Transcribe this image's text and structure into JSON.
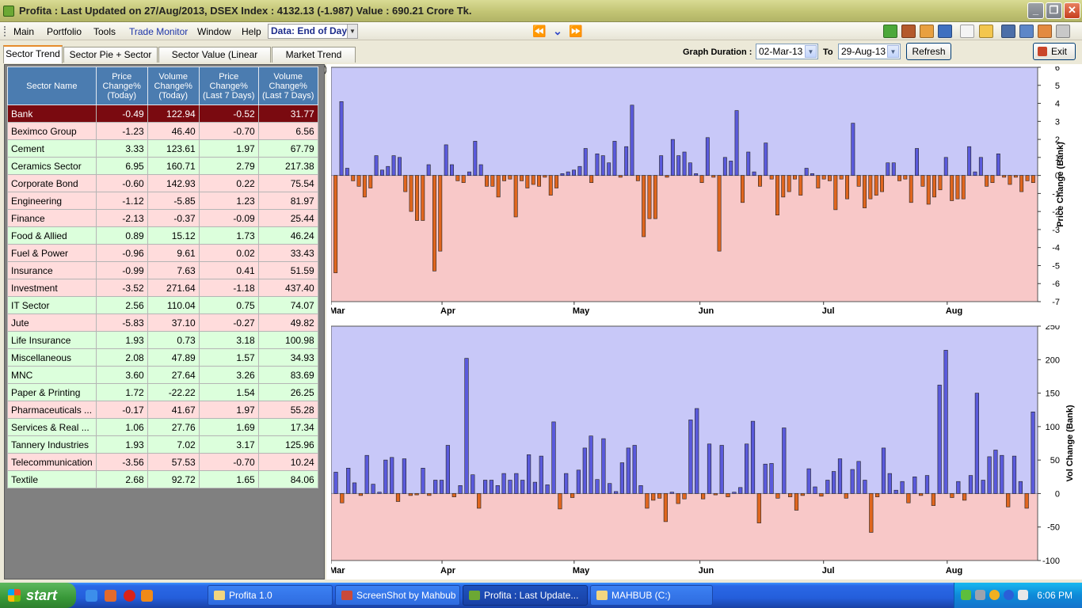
{
  "window": {
    "title": "Profita : Last Updated on 27/Aug/2013,  DSEX Index : 4132.13 (-1.987)  Value : 690.21 Crore Tk.",
    "app_icon": "profita-logo-icon",
    "controls": {
      "minimize": "_",
      "maximize": "❐",
      "close": "✕"
    }
  },
  "menubar": {
    "items": [
      "Main",
      "Portfolio",
      "Tools",
      "Trade Monitor",
      "Window",
      "Help"
    ],
    "data_select": "Data: End of Day",
    "nav": {
      "first": "⏪",
      "down": "⌄",
      "last": "⏩"
    },
    "toolbar_icons": [
      "download-icon",
      "chart-bar-icon",
      "candlestick-icon",
      "refresh-swap-icon",
      "edit-icon",
      "folder-icon",
      "portfolio-icon",
      "calculator-icon",
      "list-icon",
      "printer-icon"
    ]
  },
  "tabs": [
    "Sector Trend",
    "Sector Pie + Sector PE",
    "Sector Value (Linear Graph)",
    "Market Trend (EOD)"
  ],
  "active_tab": "Sector Trend",
  "duration": {
    "label": "Graph Duration :",
    "from": "02-Mar-13",
    "to_label": "To",
    "to": "29-Aug-13",
    "refresh": "Refresh",
    "exit": "Exit"
  },
  "table": {
    "headers": [
      "Sector Name",
      "Price Change% (Today)",
      "Volume Change% (Today)",
      "Price Change% (Last 7 Days)",
      "Volume Change% (Last 7 Days)"
    ],
    "selected_row": "Bank",
    "rows": [
      [
        "Bank",
        "-0.49",
        "122.94",
        "-0.52",
        "31.77"
      ],
      [
        "Beximco Group",
        "-1.23",
        "46.40",
        "-0.70",
        "6.56"
      ],
      [
        "Cement",
        "3.33",
        "123.61",
        "1.97",
        "67.79"
      ],
      [
        "Ceramics Sector",
        "6.95",
        "160.71",
        "2.79",
        "217.38"
      ],
      [
        "Corporate Bond",
        "-0.60",
        "142.93",
        "0.22",
        "75.54"
      ],
      [
        "Engineering",
        "-1.12",
        "-5.85",
        "1.23",
        "81.97"
      ],
      [
        "Finance",
        "-2.13",
        "-0.37",
        "-0.09",
        "25.44"
      ],
      [
        "Food & Allied",
        "0.89",
        "15.12",
        "1.73",
        "46.24"
      ],
      [
        "Fuel & Power",
        "-0.96",
        "9.61",
        "0.02",
        "33.43"
      ],
      [
        "Insurance",
        "-0.99",
        "7.63",
        "0.41",
        "51.59"
      ],
      [
        "Investment",
        "-3.52",
        "271.64",
        "-1.18",
        "437.40"
      ],
      [
        "IT Sector",
        "2.56",
        "110.04",
        "0.75",
        "74.07"
      ],
      [
        "Jute",
        "-5.83",
        "37.10",
        "-0.27",
        "49.82"
      ],
      [
        "Life Insurance",
        "1.93",
        "0.73",
        "3.18",
        "100.98"
      ],
      [
        "Miscellaneous",
        "2.08",
        "47.89",
        "1.57",
        "34.93"
      ],
      [
        "MNC",
        "3.60",
        "27.64",
        "3.26",
        "83.69"
      ],
      [
        "Paper & Printing",
        "1.72",
        "-22.22",
        "1.54",
        "26.25"
      ],
      [
        "Pharmaceuticals ...",
        "-0.17",
        "41.67",
        "1.97",
        "55.28"
      ],
      [
        "Services & Real ...",
        "1.06",
        "27.76",
        "1.69",
        "17.34"
      ],
      [
        "Tannery Industries",
        "1.93",
        "7.02",
        "3.17",
        "125.96"
      ],
      [
        "Telecommunication",
        "-3.56",
        "57.53",
        "-0.70",
        "10.24"
      ],
      [
        "Textile",
        "2.68",
        "92.72",
        "1.65",
        "84.06"
      ]
    ]
  },
  "chart_data": [
    {
      "type": "bar",
      "ylabel": "Price Change (Bank)",
      "ylim": [
        -7,
        6
      ],
      "yticks": [
        6,
        5,
        4,
        3,
        2,
        1,
        0,
        -1,
        -2,
        -3,
        -4,
        -5,
        -6,
        -7
      ],
      "xticks": [
        "Mar",
        "Apr",
        "May",
        "Jun",
        "Jul",
        "Aug"
      ],
      "colors": {
        "positive": "#5A5ADC",
        "negative": "#E0661E",
        "bg_positive": "#C8C8F8",
        "bg_negative": "#F8C8C8"
      },
      "values": [
        -5.4,
        4.1,
        0.4,
        -0.3,
        -0.6,
        -1.2,
        -0.7,
        1.1,
        0.3,
        0.5,
        1.1,
        1.0,
        -0.9,
        -2.0,
        -2.5,
        -2.5,
        0.6,
        -5.3,
        -4.2,
        1.7,
        0.6,
        -0.3,
        -0.4,
        0.2,
        1.9,
        0.6,
        -0.6,
        -0.6,
        -1.2,
        -0.3,
        -0.2,
        -2.3,
        -0.3,
        -0.7,
        -0.5,
        -0.6,
        -0.1,
        -1.1,
        -0.7,
        0.1,
        0.2,
        0.3,
        0.5,
        1.5,
        -0.4,
        1.2,
        1.1,
        0.7,
        1.9,
        -0.1,
        1.6,
        3.9,
        -0.3,
        -3.4,
        -2.4,
        -2.4,
        1.1,
        -0.1,
        2.0,
        1.1,
        1.3,
        0.7,
        0.1,
        -0.4,
        2.1,
        -0.1,
        -4.2,
        1.0,
        0.8,
        3.6,
        -1.5,
        1.3,
        0.2,
        -0.6,
        1.8,
        -0.2,
        -2.2,
        -1.2,
        -0.9,
        -0.2,
        -1.1,
        0.4,
        0.1,
        -0.7,
        -0.2,
        -0.3,
        -1.9,
        -0.2,
        -1.3,
        2.9,
        -0.6,
        -1.8,
        -1.3,
        -1.1,
        -0.9,
        0.7,
        0.7,
        -0.3,
        -0.2,
        -1.5,
        1.5,
        -0.6,
        -1.6,
        -1.2,
        -0.8,
        1.0,
        -1.4,
        -1.3,
        -1.3,
        1.6,
        0.2,
        1.0,
        -0.6,
        -0.4,
        1.2,
        -0.1,
        -0.5,
        -0.1,
        -0.9,
        -0.3,
        -0.4
      ]
    },
    {
      "type": "bar",
      "ylabel": "Vol Change (Bank)",
      "ylim": [
        -100,
        250
      ],
      "yticks": [
        250,
        200,
        150,
        100,
        50,
        0,
        -50,
        -100
      ],
      "xticks": [
        "Mar",
        "Apr",
        "May",
        "Jun",
        "Jul",
        "Aug"
      ],
      "colors": {
        "positive": "#5A5ADC",
        "negative": "#E0661E",
        "bg_positive": "#C8C8F8",
        "bg_negative": "#F8C8C8"
      },
      "values": [
        32,
        -14,
        38,
        16,
        -3,
        57,
        14,
        2,
        50,
        54,
        -12,
        52,
        -3,
        -2,
        38,
        -3,
        20,
        20,
        72,
        -5,
        12,
        202,
        28,
        -22,
        20,
        20,
        12,
        30,
        20,
        30,
        20,
        58,
        17,
        56,
        13,
        107,
        -23,
        30,
        -6,
        35,
        68,
        86,
        21,
        82,
        15,
        3,
        46,
        68,
        72,
        12,
        -22,
        -10,
        -7,
        -42,
        2,
        -15,
        -8,
        110,
        127,
        -8,
        74,
        -2,
        72,
        -5,
        2,
        9,
        74,
        108,
        -44,
        44,
        45,
        -7,
        98,
        -5,
        -25,
        -3,
        37,
        10,
        -4,
        20,
        33,
        52,
        -7,
        36,
        48,
        20,
        -58,
        -5,
        68,
        30,
        5,
        18,
        -14,
        25,
        -3,
        27,
        -18,
        162,
        214,
        -6,
        18,
        -10,
        27,
        150,
        20,
        55,
        65,
        57,
        -20,
        56,
        18,
        -22,
        122
      ]
    }
  ],
  "taskbar": {
    "start": "start",
    "quicklaunch": [
      "ie-icon",
      "media-icon",
      "opera-icon",
      "vlc-icon"
    ],
    "items": [
      "Profita 1.0",
      "ScreenShot by Mahbub",
      "Profita : Last Update...",
      "MAHBUB (C:)"
    ],
    "active_item": "Profita : Last Update...",
    "tray_icons": [
      "network-icon",
      "volume-icon",
      "antivirus-icon",
      "bluetooth-icon",
      "usb-icon"
    ],
    "clock": "6:06 PM"
  }
}
